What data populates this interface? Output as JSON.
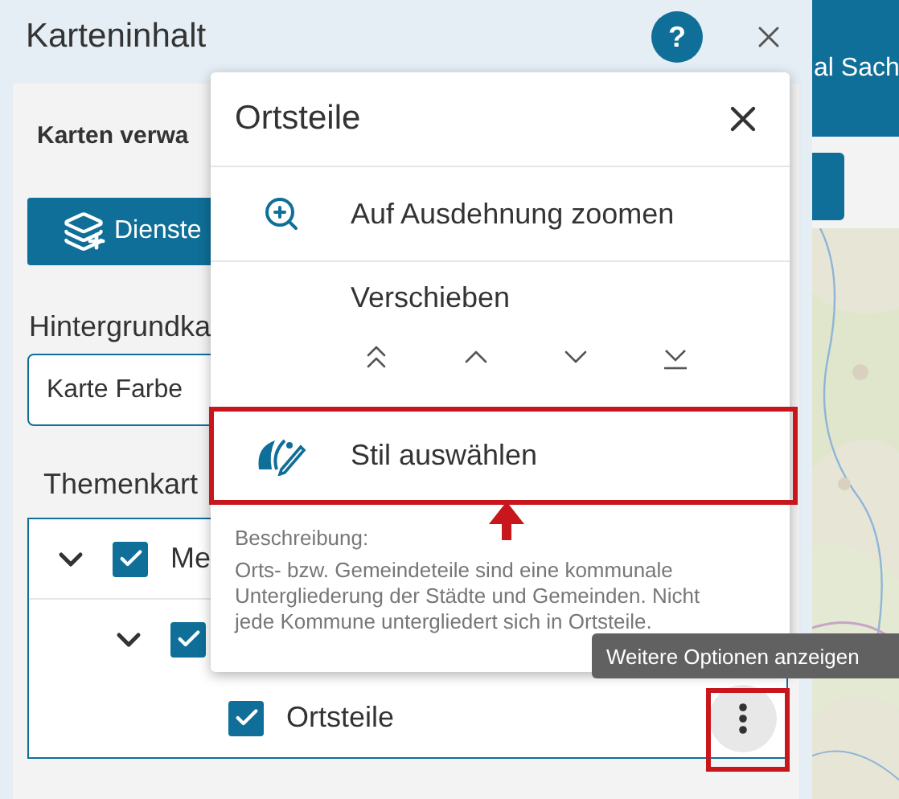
{
  "panel": {
    "title": "Karteninhalt",
    "help": "?",
    "section_title": "Karten verwa",
    "add_button": "Dienste",
    "background_label": "Hintergrundka",
    "background_select": "Karte Farbe",
    "theme_label": "Themenkart",
    "tree": [
      {
        "label": "Me",
        "checked": true,
        "expanded": true,
        "children": [
          {
            "checked": true,
            "expanded": true,
            "children": [
              {
                "label": "Ortsteile",
                "checked": true,
                "highlighted": true
              }
            ]
          }
        ]
      }
    ]
  },
  "side": {
    "header": "al Sach"
  },
  "menu": {
    "title": "Ortsteile",
    "items": [
      {
        "kind": "zoom",
        "label": "Auf Ausdehnung zoomen",
        "highlighted": false
      },
      {
        "kind": "move",
        "label": "Verschieben"
      },
      {
        "kind": "style",
        "label": "Stil auswählen",
        "highlighted": true
      }
    ],
    "description_label": "Beschreibung:",
    "description": "Orts- bzw. Gemeindeteile sind eine kommunale Untergliederung der Städte und Gemeinden. Nicht jede Kommune untergliedert sich in Ortsteile."
  },
  "tooltip": "Weitere Optionen anzeigen"
}
